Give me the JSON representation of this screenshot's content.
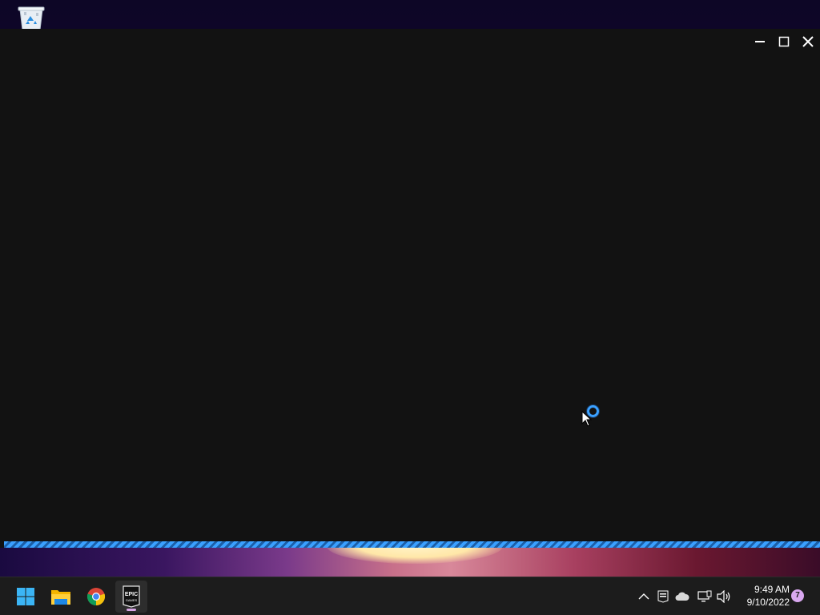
{
  "desktop": {
    "icons": [
      {
        "name": "recycle-bin",
        "icon": "recycle-bin-icon"
      }
    ]
  },
  "window": {
    "state": "loading",
    "controls": {
      "minimize": "minimize-icon",
      "maximize": "maximize-icon",
      "close": "close-icon"
    },
    "accent_color": "#3aa0ff",
    "background_color": "#121212"
  },
  "taskbar": {
    "pinned": [
      {
        "name": "start",
        "icon": "windows-start-icon"
      },
      {
        "name": "file-explorer",
        "icon": "folder-icon"
      },
      {
        "name": "chrome",
        "icon": "chrome-icon"
      },
      {
        "name": "epic-games-launcher",
        "icon": "epic-games-icon",
        "logo_text": "EPIC GAMES",
        "active": true
      }
    ],
    "tray": [
      {
        "name": "show-hidden-icons",
        "icon": "chevron-up-icon"
      },
      {
        "name": "epic-games-tray",
        "icon": "epic-games-tray-icon"
      },
      {
        "name": "onedrive",
        "icon": "cloud-icon"
      },
      {
        "name": "network",
        "icon": "network-icon"
      },
      {
        "name": "volume",
        "icon": "speaker-icon"
      }
    ],
    "clock": {
      "time": "9:49 AM",
      "date": "9/10/2022"
    },
    "notification_count": "7"
  }
}
